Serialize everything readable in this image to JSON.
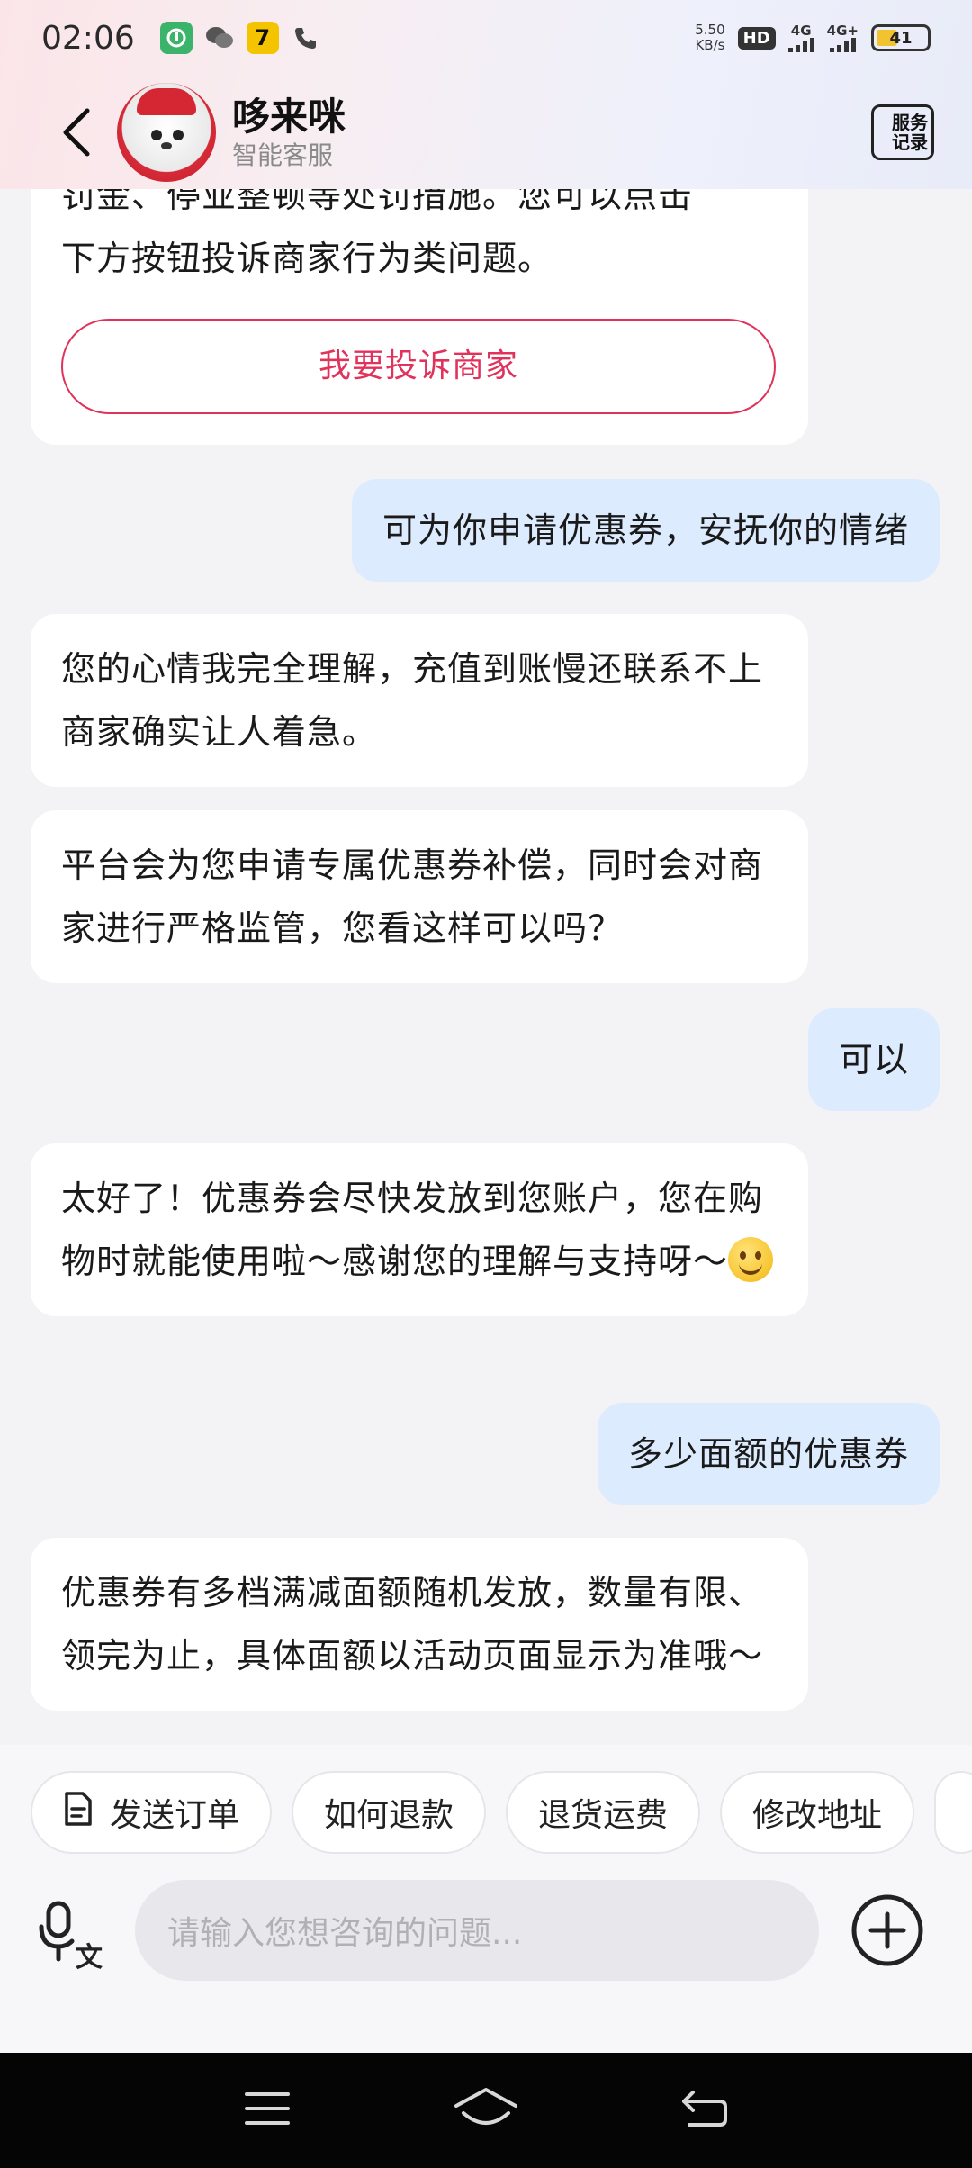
{
  "status": {
    "time": "02:06",
    "net_speed_value": "5.50",
    "net_speed_unit": "KB/s",
    "hd_label": "HD",
    "sim1_label": "4G",
    "sim2_label": "4G+",
    "battery_level": "41"
  },
  "header": {
    "bot_name": "哆来咪",
    "bot_subtitle": "智能客服",
    "service_record_line1": "服务",
    "service_record_line2": "记录"
  },
  "messages": [
    {
      "role": "bot",
      "text_line1": "罚金、停业整顿等处罚措施。您可以点击",
      "text_line2": "下方按钮投诉商家行为类问题。",
      "button_label": "我要投诉商家"
    },
    {
      "role": "user",
      "text": "可为你申请优惠券，安抚你的情绪"
    },
    {
      "role": "bot",
      "text": "您的心情我完全理解，充值到账慢还联系不上商家确实让人着急。"
    },
    {
      "role": "bot",
      "text": "平台会为您申请专属优惠券补偿，同时会对商家进行严格监管，您看这样可以吗？"
    },
    {
      "role": "user",
      "text": "可以"
    },
    {
      "role": "bot",
      "text": "太好了！优惠券会尽快发放到您账户，您在购物时就能使用啦～感谢您的理解与支持呀～",
      "emoji": "smiling-face"
    },
    {
      "role": "user",
      "text": "多少面额的优惠券"
    },
    {
      "role": "bot",
      "text": "优惠券有多档满减面额随机发放，数量有限、领完为止，具体面额以活动页面显示为准哦～"
    }
  ],
  "quick_chips": [
    {
      "label": "发送订单",
      "icon": "document-icon"
    },
    {
      "label": "如何退款"
    },
    {
      "label": "退货运费"
    },
    {
      "label": "修改地址"
    }
  ],
  "input": {
    "placeholder": "请输入您想咨询的问题..."
  },
  "colors": {
    "accent_red": "#e0325a",
    "user_bubble": "#dcebfd",
    "bot_bubble": "#ffffff"
  }
}
